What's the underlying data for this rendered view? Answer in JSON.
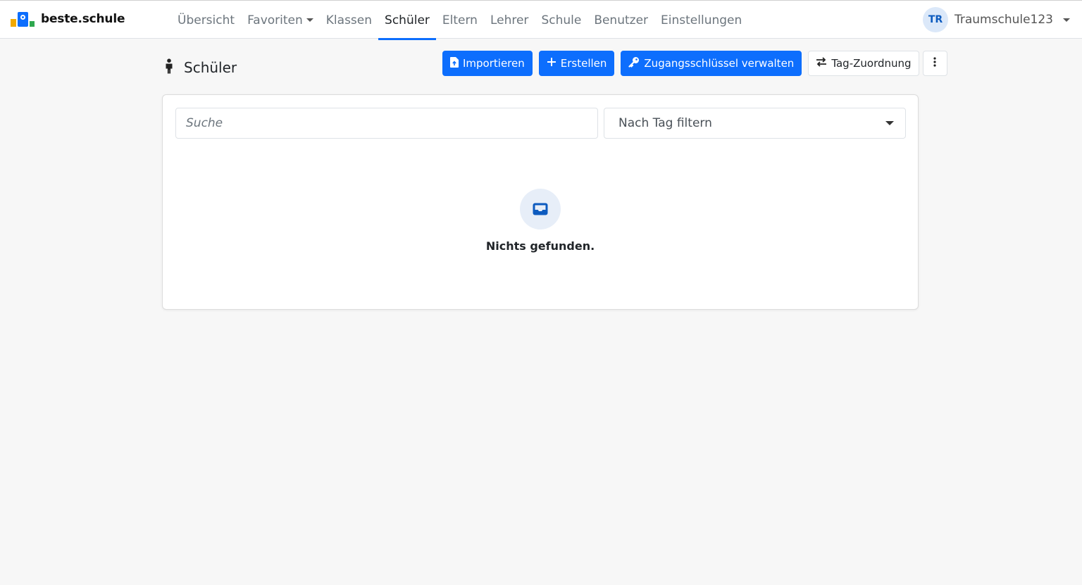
{
  "brand": {
    "name": "beste.schule"
  },
  "nav": {
    "items": [
      {
        "label": "Übersicht"
      },
      {
        "label": "Favoriten"
      },
      {
        "label": "Klassen"
      },
      {
        "label": "Schüler"
      },
      {
        "label": "Eltern"
      },
      {
        "label": "Lehrer"
      },
      {
        "label": "Schule"
      },
      {
        "label": "Benutzer"
      },
      {
        "label": "Einstellungen"
      }
    ],
    "active": "Schüler"
  },
  "user": {
    "initials": "TR",
    "name": "Traumschule123"
  },
  "page": {
    "title": "Schüler"
  },
  "toolbar": {
    "import_label": "Importieren",
    "create_label": "Erstellen",
    "keys_label": "Zugangsschlüssel verwalten",
    "tag_label": "Tag-Zuordnung"
  },
  "filters": {
    "search_placeholder": "Suche",
    "tag_filter_value": "Nach Tag filtern"
  },
  "empty": {
    "message": "Nichts gefunden."
  },
  "colors": {
    "primary": "#0d6efd",
    "background": "#f7f7f7"
  }
}
